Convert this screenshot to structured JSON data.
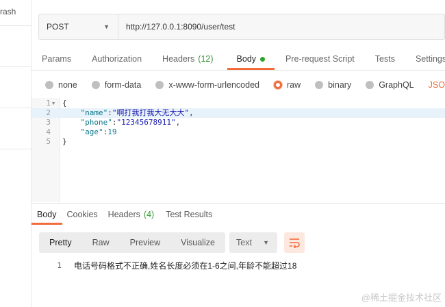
{
  "sidebar": {
    "partial_label": "rash"
  },
  "request": {
    "method": "POST",
    "url": "http://127.0.0.1:8090/user/test"
  },
  "req_tabs": [
    {
      "label": "Params"
    },
    {
      "label": "Authorization"
    },
    {
      "label": "Headers",
      "count": "(12)"
    },
    {
      "label": "Body",
      "active": true
    },
    {
      "label": "Pre-request Script"
    },
    {
      "label": "Tests"
    },
    {
      "label": "Settings"
    }
  ],
  "body_types": [
    {
      "label": "none"
    },
    {
      "label": "form-data"
    },
    {
      "label": "x-www-form-urlencoded"
    },
    {
      "label": "raw",
      "selected": true
    },
    {
      "label": "binary"
    },
    {
      "label": "GraphQL"
    }
  ],
  "raw_type": "JSON",
  "editor": {
    "line_numbers": [
      "1",
      "2",
      "3",
      "4",
      "5"
    ],
    "lines": {
      "l1": "{",
      "l2_key": "\"name\"",
      "l2_val": "\"啊打我打我大无大大\"",
      "l3_key": "\"phone\"",
      "l3_val": "\"12345678911\"",
      "l4_key": "\"age\"",
      "l4_val": "19",
      "l5": "}"
    }
  },
  "resp_tabs": [
    {
      "label": "Body",
      "active": true
    },
    {
      "label": "Cookies"
    },
    {
      "label": "Headers",
      "count": "(4)"
    },
    {
      "label": "Test Results"
    }
  ],
  "view_modes": [
    "Pretty",
    "Raw",
    "Preview",
    "Visualize"
  ],
  "format_select": "Text",
  "response": {
    "line_number": "1",
    "text": "电话号码格式不正确,姓名长度必须在1-6之间,年龄不能超过18"
  },
  "watermark": "@稀土掘金技术社区",
  "colors": {
    "accent": "#f26b3a",
    "count_green": "#3a9a3a",
    "dot_green": "#2ea32e"
  }
}
